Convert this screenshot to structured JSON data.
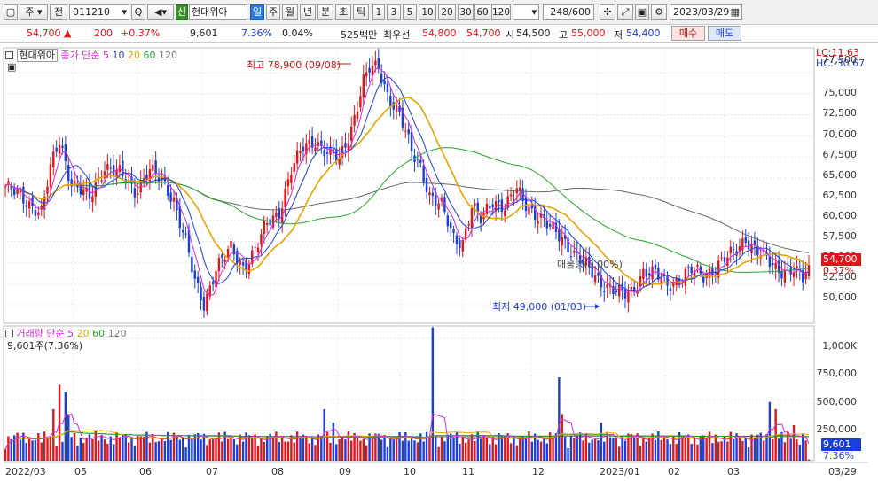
{
  "toolbar": {
    "market_label": "주",
    "series_label": "전",
    "code": "011210",
    "search_label": "Q",
    "credit_badge": "신",
    "stock_name": "현대위아",
    "periods": [
      "일",
      "주",
      "월",
      "년",
      "분",
      "초",
      "틱"
    ],
    "active_period": "일",
    "intervals": [
      "1",
      "3",
      "5",
      "10",
      "20",
      "30",
      "60",
      "120"
    ],
    "count": "248/600",
    "date": "2023/03/29"
  },
  "quote": {
    "price": "54,700",
    "change": "200",
    "change_pct": "+0.37%",
    "volume": "9,601",
    "volume_pct": "7.36%",
    "turnover_pct": "0.04%",
    "amount": "525백만",
    "best_ask_label": "최우선",
    "best_ask": "54,800",
    "best_bid": "54,700",
    "open_label": "시",
    "open": "54,500",
    "high_label": "고",
    "high": "55,000",
    "low_label": "저",
    "low": "54,400",
    "buy_label": "매수",
    "sell_label": "매도"
  },
  "price_panel": {
    "name": "현대위아",
    "ma_label": "종가 단순",
    "ma_periods": [
      "5",
      "10",
      "20",
      "60",
      "120"
    ],
    "lc": "LC:11.63",
    "hc": "HC:-30.67",
    "high_annotation": "최고 78,900 (09/08)",
    "low_annotation": "최저 49,000 (01/03)",
    "volume_profile_label": "매물량(0.00%)",
    "price_tag": "54,700",
    "price_tag_pct": "0.37%",
    "y_labels": [
      "77,500",
      "75,000",
      "72,500",
      "70,000",
      "67,500",
      "65,000",
      "62,500",
      "60,000",
      "57,500",
      "55,000",
      "52,500",
      "50,000"
    ]
  },
  "volume_panel": {
    "label": "거래량 단순",
    "ma_periods": [
      "5",
      "20",
      "60",
      "120"
    ],
    "value_label": "9,601주(7.36%)",
    "tag": "9,601",
    "tag_pct": "7.36%",
    "y_labels": [
      "1,000K",
      "750,000",
      "500,000",
      "250,000"
    ]
  },
  "x_axis": {
    "labels": [
      "2022/03",
      "05",
      "06",
      "07",
      "08",
      "09",
      "10",
      "11",
      "12",
      "2023/01",
      "02",
      "03",
      "03/29"
    ]
  },
  "chart_data": {
    "type": "candlestick",
    "ylim": [
      48000,
      80000
    ],
    "anchors": [
      [
        0,
        64000
      ],
      [
        6,
        62500
      ],
      [
        12,
        61000
      ],
      [
        15,
        66000
      ],
      [
        18,
        69500
      ],
      [
        22,
        64500
      ],
      [
        28,
        62500
      ],
      [
        33,
        66500
      ],
      [
        38,
        65500
      ],
      [
        43,
        63500
      ],
      [
        48,
        66000
      ],
      [
        52,
        64500
      ],
      [
        56,
        62500
      ],
      [
        60,
        57500
      ],
      [
        63,
        52500
      ],
      [
        66,
        50000
      ],
      [
        70,
        54500
      ],
      [
        75,
        56500
      ],
      [
        79,
        54500
      ],
      [
        83,
        56500
      ],
      [
        87,
        59500
      ],
      [
        91,
        61000
      ],
      [
        95,
        66000
      ],
      [
        99,
        68500
      ],
      [
        103,
        69500
      ],
      [
        107,
        68000
      ],
      [
        111,
        67000
      ],
      [
        115,
        71000
      ],
      [
        119,
        76500
      ],
      [
        121,
        77800
      ],
      [
        124,
        78000
      ],
      [
        127,
        75000
      ],
      [
        131,
        72500
      ],
      [
        135,
        68000
      ],
      [
        138,
        66500
      ],
      [
        141,
        63000
      ],
      [
        145,
        61500
      ],
      [
        149,
        58000
      ],
      [
        152,
        57500
      ],
      [
        155,
        61500
      ],
      [
        158,
        60000
      ],
      [
        162,
        62500
      ],
      [
        166,
        61500
      ],
      [
        170,
        63500
      ],
      [
        173,
        62000
      ],
      [
        177,
        60500
      ],
      [
        181,
        59000
      ],
      [
        185,
        58000
      ],
      [
        189,
        56000
      ],
      [
        193,
        54500
      ],
      [
        197,
        53000
      ],
      [
        201,
        52000
      ],
      [
        205,
        51000
      ],
      [
        208,
        51500
      ],
      [
        212,
        54000
      ],
      [
        216,
        53500
      ],
      [
        220,
        52500
      ],
      [
        224,
        53000
      ],
      [
        228,
        54000
      ],
      [
        232,
        53500
      ],
      [
        236,
        54500
      ],
      [
        240,
        55500
      ],
      [
        243,
        56500
      ],
      [
        246,
        58000
      ],
      [
        249,
        56500
      ],
      [
        252,
        55500
      ],
      [
        256,
        54500
      ],
      [
        259,
        54000
      ],
      [
        262,
        54000
      ],
      [
        265,
        53000
      ],
      [
        267,
        54700
      ]
    ],
    "volume_ylim": [
      0,
      1100000
    ],
    "volume_ma_colors": {
      "5": "#d62ad6",
      "20": "#e0a800",
      "60": "#2aa12a",
      "120": "#555555"
    },
    "ma_colors": {
      "5": "#d62ad6",
      "10": "#1b3ed8",
      "20": "#e8a400",
      "60": "#2aa12a",
      "120": "#666666"
    },
    "up_color": "#e0161b",
    "down_color": "#1b3ed8"
  }
}
